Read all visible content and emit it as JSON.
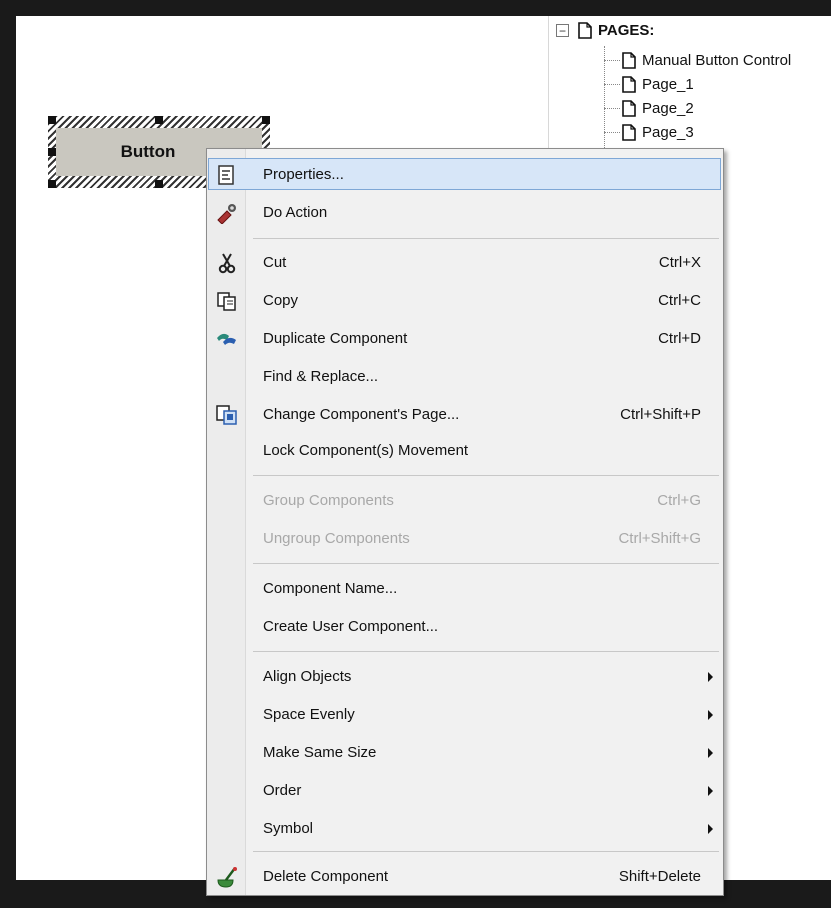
{
  "tree": {
    "expander": "−",
    "root": "PAGES:",
    "children": [
      "Manual Button Control",
      "Page_1",
      "Page_2",
      "Page_3"
    ]
  },
  "design": {
    "button_label": "Button"
  },
  "menu": {
    "items": [
      {
        "label": "Properties...",
        "icon": "properties-icon"
      },
      {
        "label": "Do Action",
        "icon": "do-action-icon"
      },
      {
        "label": "Cut",
        "shortcut": "Ctrl+X",
        "icon": "scissors-icon"
      },
      {
        "label": "Copy",
        "shortcut": "Ctrl+C",
        "icon": "copy-icon"
      },
      {
        "label": "Duplicate Component",
        "shortcut": "Ctrl+D",
        "icon": "duplicate-icon"
      },
      {
        "label": "Find & Replace..."
      },
      {
        "label": "Change Component's Page...",
        "shortcut": "Ctrl+Shift+P",
        "icon": "change-page-icon"
      },
      {
        "label": "Lock Component(s) Movement"
      },
      {
        "label": "Group Components",
        "shortcut": "Ctrl+G",
        "disabled": true
      },
      {
        "label": "Ungroup Components",
        "shortcut": "Ctrl+Shift+G",
        "disabled": true
      },
      {
        "label": "Component Name..."
      },
      {
        "label": "Create User Component..."
      },
      {
        "label": "Align Objects",
        "submenu": true
      },
      {
        "label": "Space Evenly",
        "submenu": true
      },
      {
        "label": "Make Same Size",
        "submenu": true
      },
      {
        "label": "Order",
        "submenu": true
      },
      {
        "label": "Symbol",
        "submenu": true
      },
      {
        "label": "Delete Component",
        "shortcut": "Shift+Delete",
        "icon": "delete-icon"
      }
    ]
  },
  "colors": {
    "highlight": "#d7e6f8",
    "highlight_border": "#7ea7d6",
    "disabled_text": "#a8a8a8"
  }
}
